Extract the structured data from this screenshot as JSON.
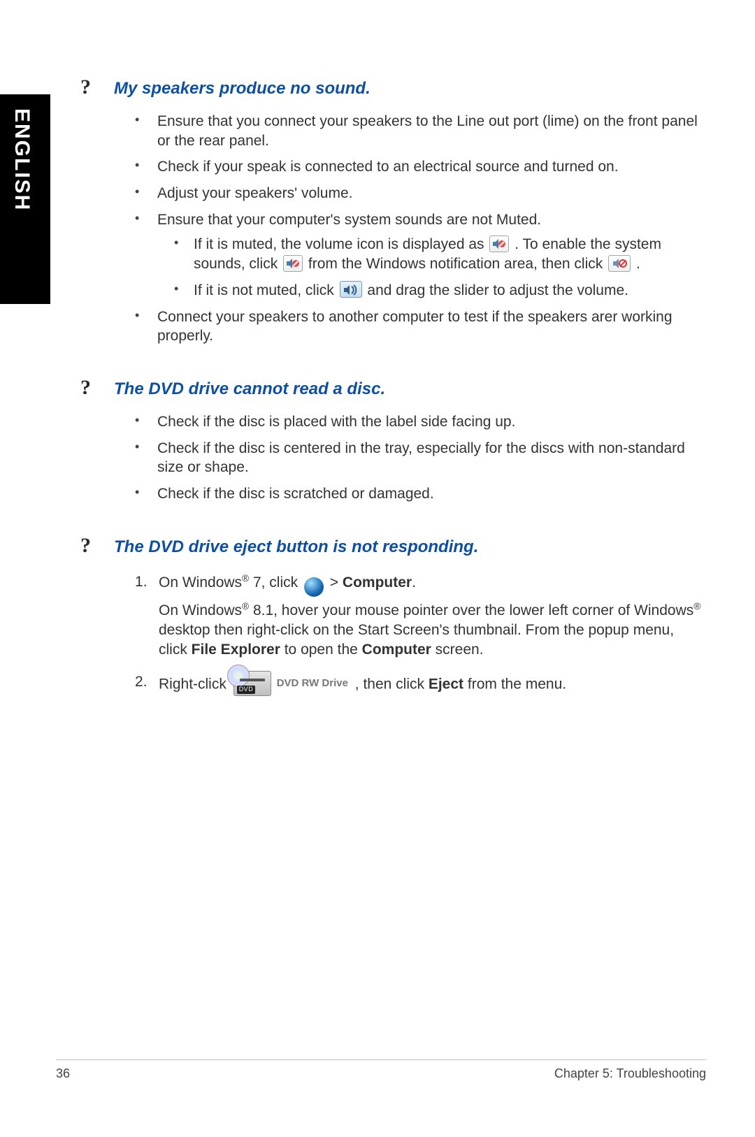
{
  "side_tab": "ENGLISH",
  "sections": {
    "speakers": {
      "title": "My speakers produce no sound.",
      "b1": "Ensure that you connect your speakers to the Line out port (lime) on the front panel or the rear panel.",
      "b2": "Check if your speak is connected to an electrical source and turned on.",
      "b3": "Adjust your speakers' volume.",
      "b4": "Ensure that your computer's system sounds are not Muted.",
      "b4a_pre": "If it is muted, the volume icon is displayed as ",
      "b4a_mid1": ". To enable the system sounds, click ",
      "b4a_mid2": " from the Windows notification area, then click ",
      "b4a_end": " .",
      "b4b_pre": "If it is not muted, click ",
      "b4b_end": " and drag the slider to adjust the volume.",
      "b5": "Connect your speakers to another computer to test if the speakers arer working properly."
    },
    "dvd_read": {
      "title": "The DVD drive cannot read a disc.",
      "b1": "Check if the disc is placed with the label side facing up.",
      "b2": "Check if the disc is centered in the tray, especially for the discs with non-standard size or shape.",
      "b3": "Check if the disc is scratched or damaged."
    },
    "dvd_eject": {
      "title": "The DVD drive eject button is not responding.",
      "s1_pre": "On Windows",
      "s1_mid": " 7, click ",
      "s1_gt": " > ",
      "s1_computer": "Computer",
      "s1_end": ".",
      "s1b_pre": "On Windows",
      "s1b_mid": " 8.1, hover your mouse pointer over the lower left corner of Windows",
      "s1b_mid2": " desktop then right-click on the Start Screen's thumbnail. From the popup menu, click ",
      "s1b_fe": "File Explorer",
      "s1b_mid3": " to open the ",
      "s1b_comp": "Computer",
      "s1b_end": " screen.",
      "s2_pre": "Right-click ",
      "s2_drive_label": "DVD RW Drive",
      "s2_mid": ", then click ",
      "s2_eject": "Eject",
      "s2_end": " from the menu."
    }
  },
  "footer": {
    "page_number": "36",
    "chapter": "Chapter 5: Troubleshooting"
  }
}
